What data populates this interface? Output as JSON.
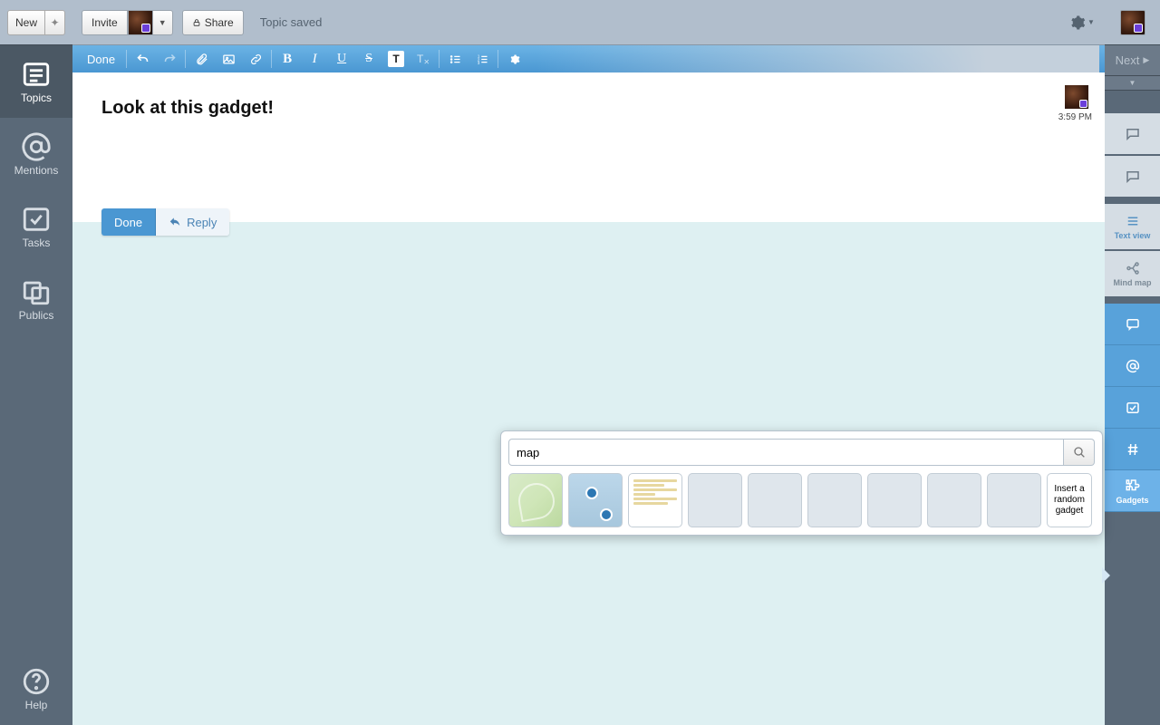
{
  "left_nav": {
    "new_label": "New",
    "items": [
      {
        "label": "Topics"
      },
      {
        "label": "Mentions"
      },
      {
        "label": "Tasks"
      },
      {
        "label": "Publics"
      }
    ],
    "help_label": "Help"
  },
  "top_bar": {
    "invite_label": "Invite",
    "share_label": "Share",
    "status": "Topic saved"
  },
  "far_right": {
    "next_label": "Next",
    "text_view_label": "Text view",
    "mind_map_label": "Mind map",
    "gadgets_label": "Gadgets"
  },
  "editor_toolbar": {
    "done_label": "Done"
  },
  "post": {
    "title": "Look at this gadget!",
    "time": "3:59 PM",
    "done_label": "Done",
    "reply_label": "Reply"
  },
  "gadget_popover": {
    "search_value": "map",
    "random_label": "Insert a random gadget"
  }
}
